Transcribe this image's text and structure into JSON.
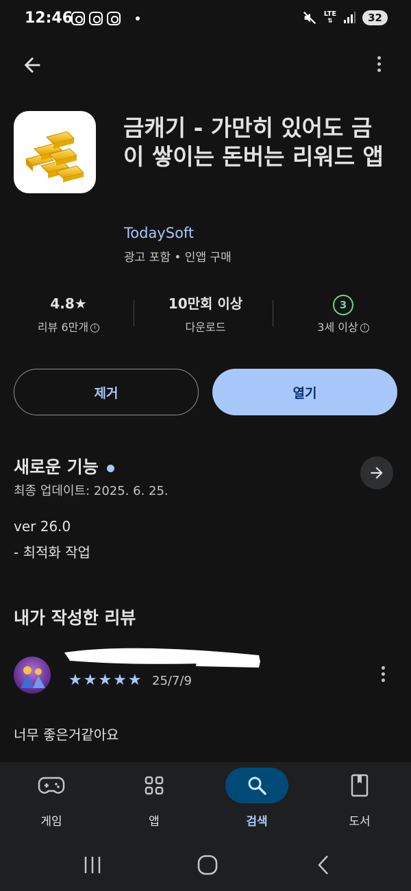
{
  "status_bar": {
    "time": "12:46",
    "network": "LTE",
    "battery": "32"
  },
  "app": {
    "title": "금캐기 - 가만히 있어도 금이 쌓이는 돈버는 리워드 앱",
    "developer": "TodaySoft",
    "meta": "광고 포함 • 인앱 구매",
    "icon": "gold-bars-icon"
  },
  "stats": {
    "rating": "4.8★",
    "reviews": "리뷰 6만개",
    "downloads": "10만회 이상",
    "downloads_label": "다운로드",
    "age_rating": "3",
    "age_label": "3세 이상"
  },
  "buttons": {
    "uninstall": "제거",
    "open": "열기"
  },
  "whats_new": {
    "title": "새로운 기능",
    "last_updated": "최종 업데이트: 2025. 6. 25.",
    "version": "ver 26.0",
    "note": "- 최적화 작업"
  },
  "my_review": {
    "title": "내가 작성한 리뷰",
    "stars": "★★★★★",
    "rating": 5,
    "date": "25/7/9",
    "text": "너무 좋은거같아요"
  },
  "bottom_nav": {
    "items": [
      {
        "label": "게임",
        "icon": "gamepad-icon"
      },
      {
        "label": "앱",
        "icon": "apps-grid-icon"
      },
      {
        "label": "검색",
        "icon": "search-icon"
      },
      {
        "label": "도서",
        "icon": "book-icon"
      }
    ],
    "active_index": 2
  },
  "colors": {
    "background": "#131314",
    "accent": "#a8c7fa",
    "age_green": "#6dd58c"
  }
}
